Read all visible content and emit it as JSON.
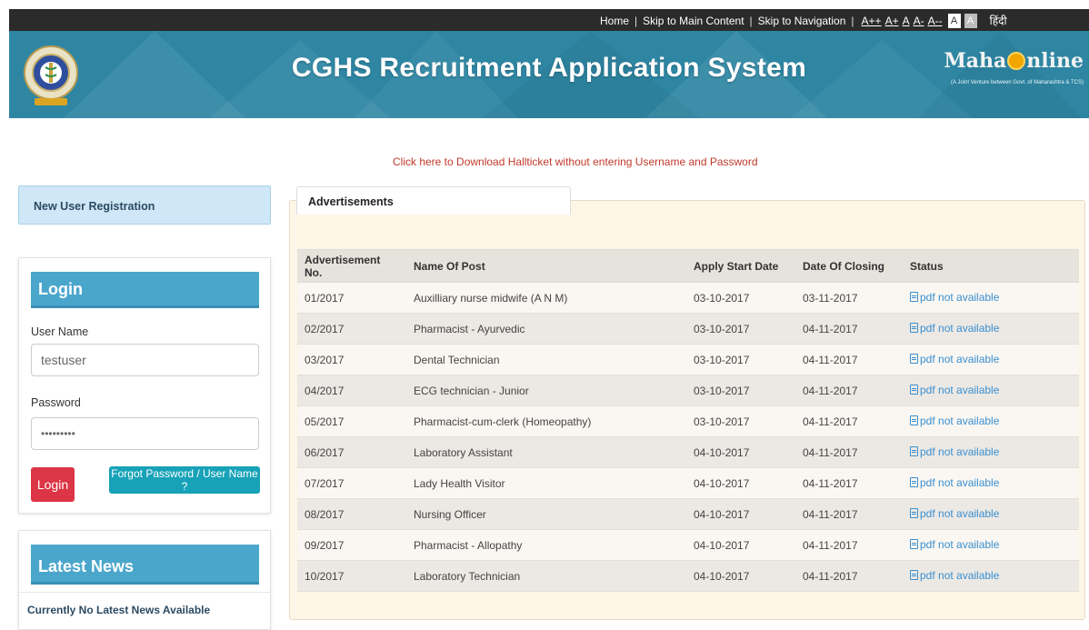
{
  "topbar": {
    "links": [
      "Home",
      "Skip to Main Content",
      "Skip to Navigation"
    ],
    "font_buttons": [
      "A++",
      "A+",
      "A",
      "A-",
      "A--"
    ],
    "contrast_buttons": [
      "A",
      "A"
    ],
    "language": "हिंदी"
  },
  "header": {
    "title": "CGHS Recruitment Application System",
    "partner_logo_part1": "Maha",
    "partner_logo_part2": "nline",
    "partner_tagline": "(A Joint Venture between Govt. of Maharashtra & TCS)",
    "emblem_icon": "cghs-emblem-icon"
  },
  "hallticket_link": "Click here to Download Hallticket without entering Username and Password",
  "sidebar": {
    "new_user_registration": "New User Registration",
    "login": {
      "heading": "Login",
      "username_label": "User Name",
      "username_value": "testuser",
      "password_label": "Password",
      "password_value": "•••••••••",
      "login_button": "Login",
      "forgot_button": "Forgot Password / User Name ?"
    },
    "news": {
      "heading": "Latest News",
      "text": "Currently No Latest News Available"
    }
  },
  "advertisements": {
    "tab_label": "Advertisements",
    "columns": [
      "Advertisement No.",
      "Name Of Post",
      "Apply Start Date",
      "Date Of Closing",
      "Status"
    ],
    "rows": [
      [
        "01/2017",
        "Auxilliary nurse midwife (A N M)",
        "03-10-2017",
        "03-11-2017",
        "pdf not available"
      ],
      [
        "02/2017",
        "Pharmacist - Ayurvedic",
        "03-10-2017",
        "04-11-2017",
        "pdf not available"
      ],
      [
        "03/2017",
        "Dental Technician",
        "03-10-2017",
        "04-11-2017",
        "pdf not available"
      ],
      [
        "04/2017",
        "ECG technician - Junior",
        "03-10-2017",
        "04-11-2017",
        "pdf not available"
      ],
      [
        "05/2017",
        "Pharmacist-cum-clerk (Homeopathy)",
        "03-10-2017",
        "04-11-2017",
        "pdf not available"
      ],
      [
        "06/2017",
        "Laboratory Assistant",
        "04-10-2017",
        "04-11-2017",
        "pdf not available"
      ],
      [
        "07/2017",
        "Lady Health Visitor",
        "04-10-2017",
        "04-11-2017",
        "pdf not available"
      ],
      [
        "08/2017",
        "Nursing Officer",
        "04-10-2017",
        "04-11-2017",
        "pdf not available"
      ],
      [
        "09/2017",
        "Pharmacist - Allopathy",
        "04-10-2017",
        "04-11-2017",
        "pdf not available"
      ],
      [
        "10/2017",
        "Laboratory Technician",
        "04-10-2017",
        "04-11-2017",
        "pdf not available"
      ]
    ]
  },
  "colors": {
    "banner": "#2e86a3",
    "panel_heading": "#4ba6cc",
    "login_button": "#dc3545",
    "forgot_button": "#17a2b8",
    "link_red": "#c0392b",
    "status_link": "#3a8fd0",
    "ad_panel_bg": "#fdf5e6"
  }
}
